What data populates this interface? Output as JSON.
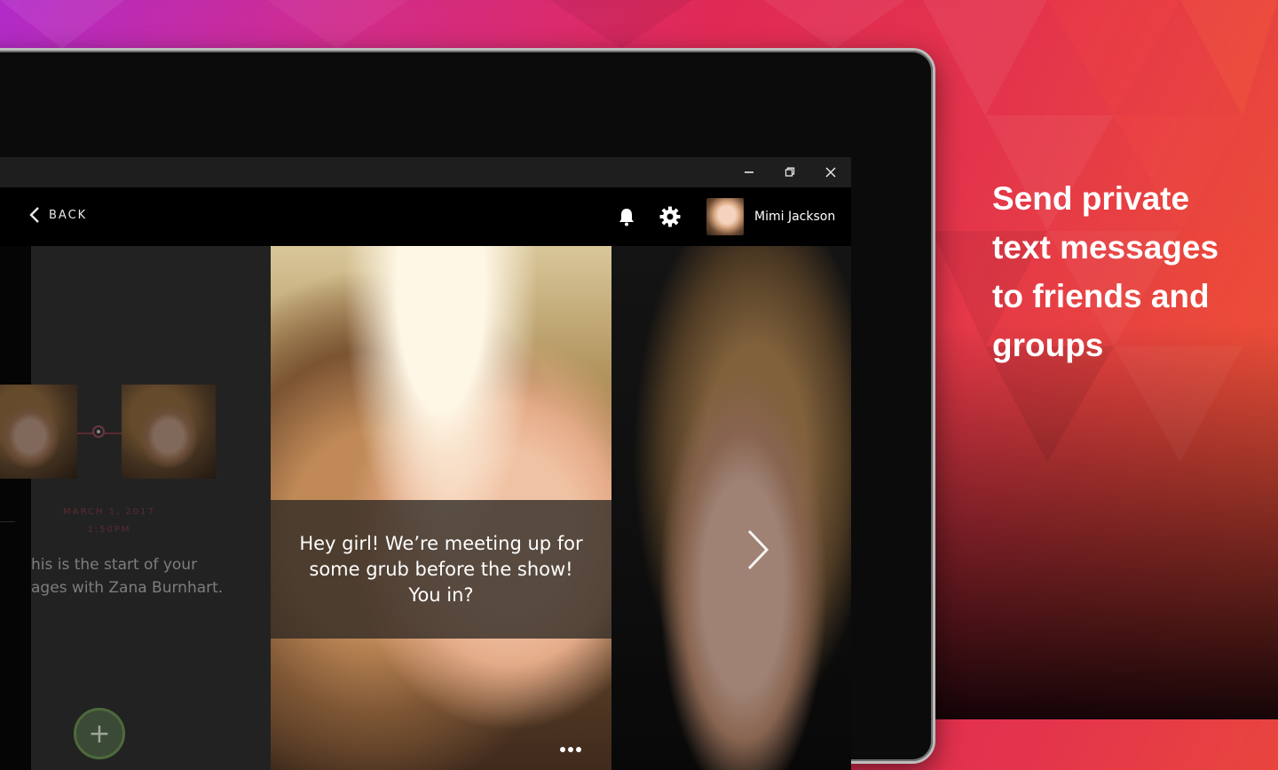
{
  "window": {
    "minimize_icon": "minimize-icon",
    "restore_icon": "restore-icon",
    "close_icon": "close-icon"
  },
  "appbar": {
    "back_label": "BACK",
    "user_name": "Mimi Jackson",
    "icons": [
      "chevron-left-icon",
      "bell-icon",
      "gear-icon"
    ]
  },
  "conversation": {
    "date": "MARCH 1, 2017",
    "time": "1:50PM",
    "intro_line1": "his is the start of your",
    "intro_line2": "ages with Zana Burnhart."
  },
  "message": {
    "text": "Hey girl! We’re meeting up for some grub before the show! You in?"
  },
  "promo": {
    "line1": "Send private",
    "line2": "text messages",
    "line3": "to friends and",
    "line4": "groups"
  },
  "colors": {
    "accent_date": "#5b2a33",
    "fab_ring": "#4d6a3c",
    "background_start": "#b12bc9",
    "background_end": "#f05a34"
  }
}
